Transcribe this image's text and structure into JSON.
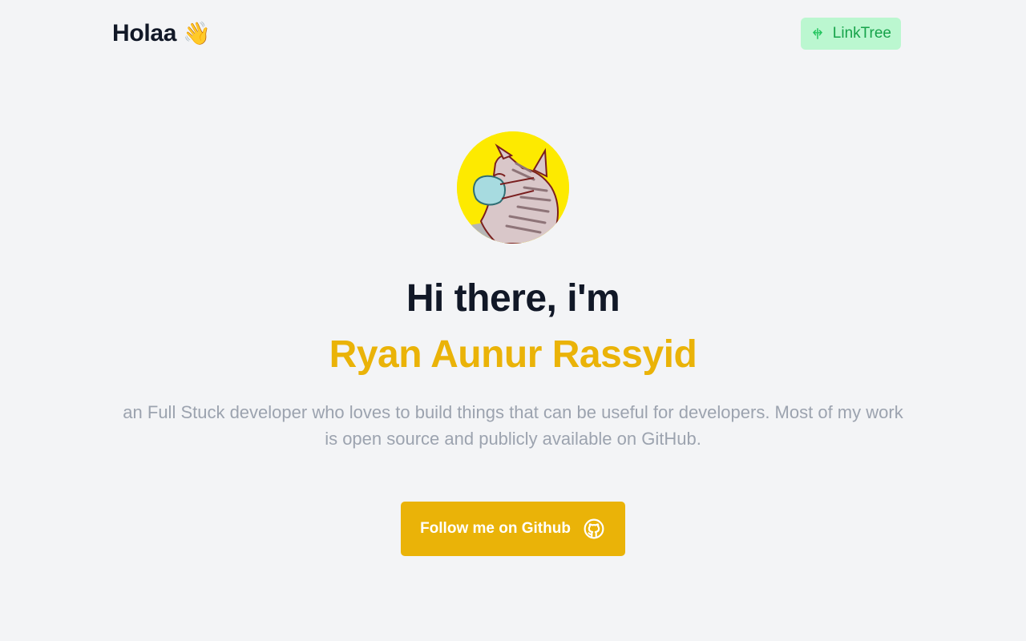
{
  "header": {
    "brand_text": "Holaa",
    "brand_emoji": "👋",
    "linktree_label": "LinkTree",
    "linktree_icon": "linktree-icon"
  },
  "hero": {
    "avatar_alt": "cat-with-mask-avatar",
    "greeting": "Hi there, i'm",
    "name": "Ryan Aunur Rassyid",
    "bio": "an Full Stuck developer who loves to build things that can be useful for developers. Most of my work is open source and publicly available on GitHub.",
    "cta_label": "Follow me on Github",
    "cta_icon": "github-icon"
  },
  "colors": {
    "background": "#f3f4f6",
    "accent": "#eab308",
    "linktree_bg": "#bbf7d0",
    "linktree_text": "#16a34a",
    "heading": "#111827",
    "muted": "#9ca3af"
  }
}
